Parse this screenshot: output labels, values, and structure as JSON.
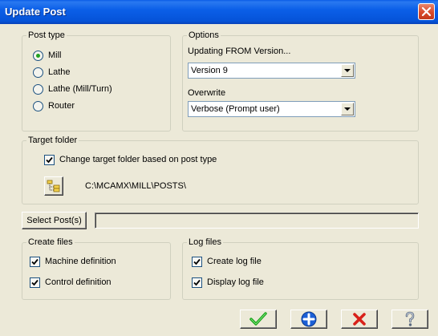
{
  "window": {
    "title": "Update Post"
  },
  "post_type": {
    "legend": "Post type",
    "options": [
      {
        "label": "Mill",
        "selected": true
      },
      {
        "label": "Lathe",
        "selected": false
      },
      {
        "label": "Lathe (Mill/Turn)",
        "selected": false
      },
      {
        "label": "Router",
        "selected": false
      }
    ]
  },
  "options": {
    "legend": "Options",
    "updating_from_label": "Updating FROM Version...",
    "updating_from_value": "Version 9",
    "overwrite_label": "Overwrite",
    "overwrite_value": "Verbose (Prompt user)"
  },
  "target_folder": {
    "legend": "Target folder",
    "change_label": "Change target folder based on post type",
    "change_checked": true,
    "path": "C:\\MCAMX\\MILL\\POSTS\\"
  },
  "select_posts": {
    "button_label": "Select Post(s)",
    "field_value": ""
  },
  "create_files": {
    "legend": "Create files",
    "machine_definition_label": "Machine definition",
    "machine_definition_checked": true,
    "control_definition_label": "Control definition",
    "control_definition_checked": true
  },
  "log_files": {
    "legend": "Log files",
    "create_log_label": "Create log file",
    "create_log_checked": true,
    "display_log_label": "Display log file",
    "display_log_checked": true
  },
  "footer": {
    "ok_icon": "green-checkmark-icon",
    "add_icon": "blue-plus-icon",
    "cancel_icon": "red-x-icon",
    "help_icon": "help-question-icon"
  }
}
